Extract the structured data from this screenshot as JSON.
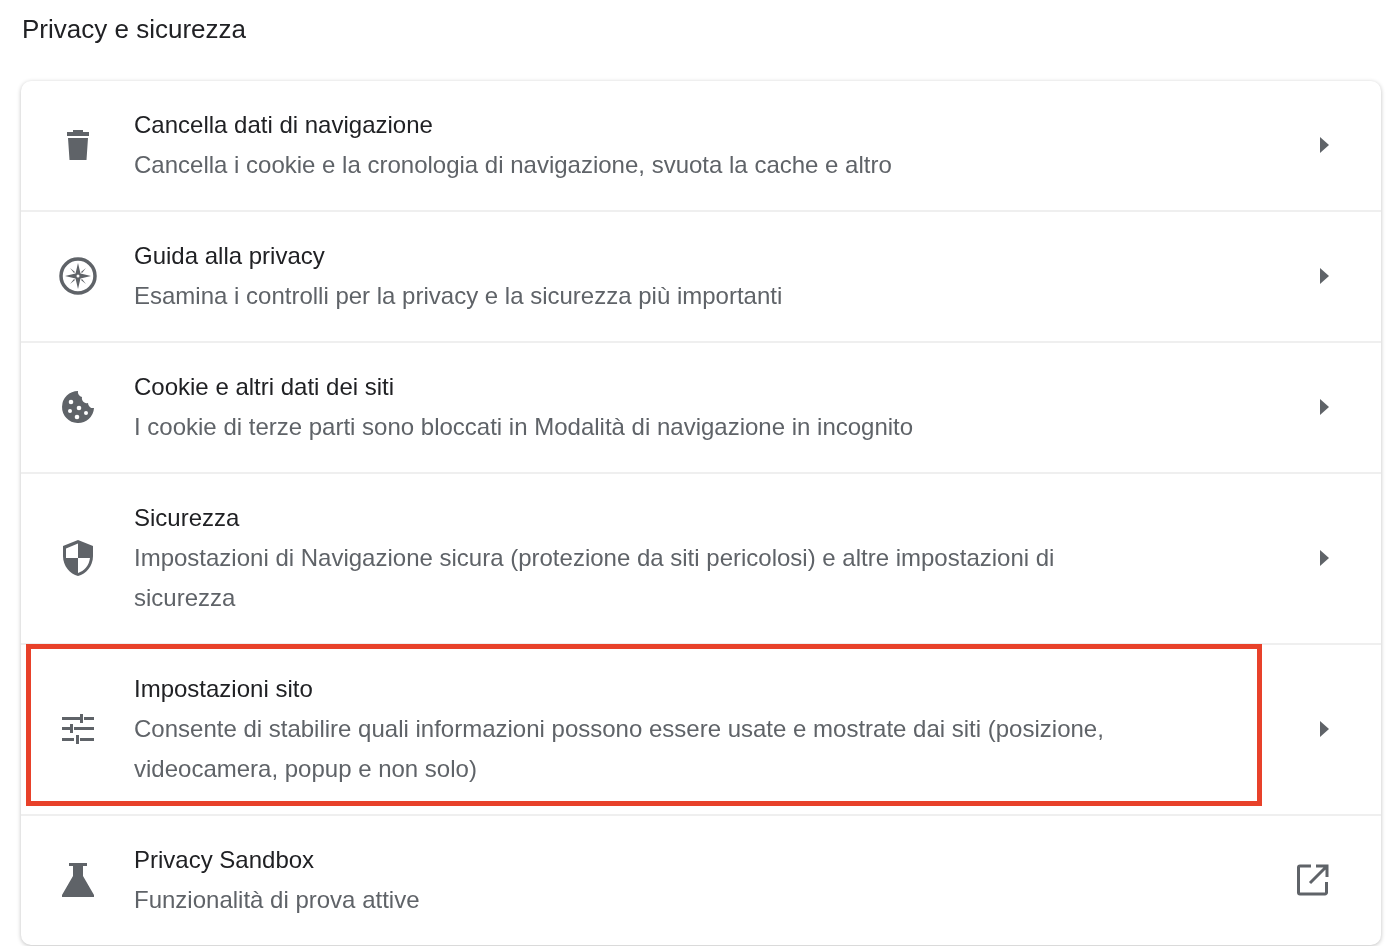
{
  "page_title": "Privacy e sicurezza",
  "items": [
    {
      "title": "Cancella dati di navigazione",
      "description": "Cancella i cookie e la cronologia di navigazione, svuota la cache e altro",
      "kind": "arrow",
      "highlighted": false
    },
    {
      "title": "Guida alla privacy",
      "description": "Esamina i controlli per la privacy e la sicurezza più importanti",
      "kind": "arrow",
      "highlighted": false
    },
    {
      "title": "Cookie e altri dati dei siti",
      "description": "I cookie di terze parti sono bloccati in Modalità di navigazione in incognito",
      "kind": "arrow",
      "highlighted": false
    },
    {
      "title": "Sicurezza",
      "description": "Impostazioni di Navigazione sicura (protezione da siti pericolosi) e altre impostazioni di sicurezza",
      "kind": "arrow",
      "highlighted": false
    },
    {
      "title": "Impostazioni sito",
      "description": "Consente di stabilire quali informazioni possono essere usate e mostrate dai siti (posizione, videocamera, popup e non solo)",
      "kind": "arrow",
      "highlighted": true
    },
    {
      "title": "Privacy Sandbox",
      "description": "Funzionalità di prova attive",
      "kind": "external",
      "highlighted": false
    }
  ]
}
